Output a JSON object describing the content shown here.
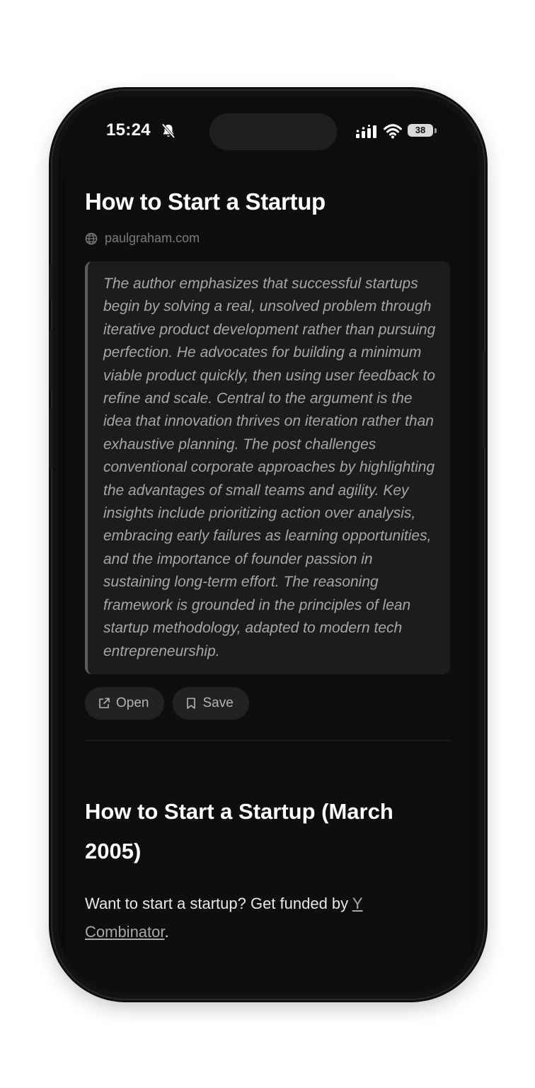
{
  "status_bar": {
    "time": "15:24",
    "battery": "38",
    "icons": [
      "bell-slash-icon",
      "signal-icon",
      "wifi-icon",
      "battery-icon"
    ]
  },
  "article": {
    "title": "How to Start a Startup",
    "source": "paulgraham.com",
    "source_icon": "globe-icon",
    "summary": "The author emphasizes that successful startups begin by solving a real, unsolved problem through iterative product development rather than pursuing perfection. He advocates for building a minimum viable product quickly, then using user feedback to refine and scale. Central to the argument is the idea that innovation thrives on iteration rather than exhaustive planning. The post challenges conventional corporate approaches by highlighting the advantages of small teams and agility. Key insights include prioritizing action over analysis, embracing early failures as learning opportunities, and the importance of founder passion in sustaining long-term effort. The reasoning framework is grounded in the principles of lean startup methodology, adapted to modern tech entrepreneurship.",
    "actions": {
      "open_label": "Open",
      "open_icon": "external-link-icon",
      "save_label": "Save",
      "save_icon": "bookmark-icon"
    }
  },
  "body": {
    "heading": "How to Start a Startup (March 2005)",
    "para_text": "Want to start a startup? Get funded by ",
    "link_text": "Y Combinator",
    "para_end": "."
  },
  "colors": {
    "background": "#0b0b0b",
    "summary_bg": "#1c1c1c",
    "button_bg": "#222222",
    "text_primary": "#ffffff",
    "text_muted": "#a6a6a6"
  }
}
